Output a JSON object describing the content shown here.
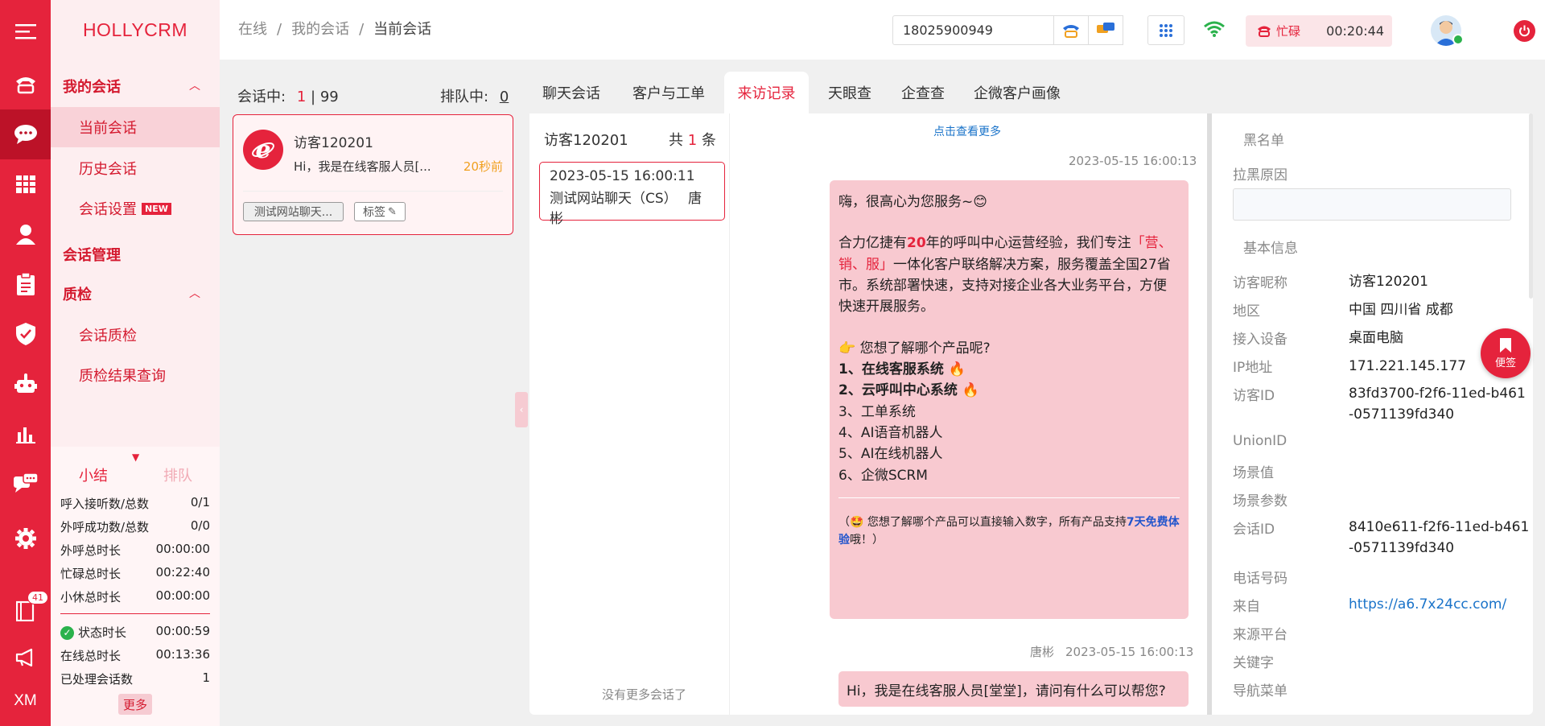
{
  "rail": {
    "badge": "41",
    "footer": "XM"
  },
  "logo": "HOLLYCRM",
  "menu": {
    "group1": "我的会话",
    "current": "当前会话",
    "history": "历史会话",
    "settings": "会话设置",
    "new_badge": "NEW",
    "manage": "会话管理",
    "qc": "质检",
    "qc_item": "会话质检",
    "qc_result": "质检结果查询"
  },
  "stats": {
    "tab_summary": "小结",
    "tab_queue": "排队",
    "rows": [
      {
        "label": "呼入接听数/总数",
        "value": "0/1"
      },
      {
        "label": "外呼成功数/总数",
        "value": "0/0"
      },
      {
        "label": "外呼总时长",
        "value": "00:00:00"
      },
      {
        "label": "忙碌总时长",
        "value": "00:22:40"
      },
      {
        "label": "小休总时长",
        "value": "00:00:00"
      }
    ],
    "rows2": [
      {
        "label": "状态时长",
        "value": "00:00:59"
      },
      {
        "label": "在线总时长",
        "value": "00:13:36"
      },
      {
        "label": "已处理会话数",
        "value": "1"
      }
    ],
    "more": "更多"
  },
  "breadcrumb": {
    "a": "在线",
    "b": "我的会话",
    "c": "当前会话",
    "sep": "/"
  },
  "topbar": {
    "phone": "18025900949",
    "status": "忙碌",
    "timer": "00:20:44"
  },
  "sessions": {
    "active_label": "会话中:",
    "active_count": "1",
    "active_sep": "|",
    "active_total": "99",
    "queue_label": "排队中:",
    "queue_count": "0",
    "card": {
      "name": "访客120201",
      "preview": "Hi，我是在线客服人员[...",
      "time": "20秒前",
      "tag1": "测试网站聊天...",
      "tag2": "标签"
    }
  },
  "tabs": [
    "聊天会话",
    "客户与工单",
    "来访记录",
    "天眼查",
    "企查查",
    "企微客户画像"
  ],
  "records": {
    "visitor": "访客120201",
    "total_prefix": "共",
    "total_count": "1",
    "total_suffix": "条",
    "item_time": "2023-05-15 16:00:11",
    "item_title": "测试网站聊天（CS）",
    "item_agent": "唐彬",
    "no_more": "没有更多会话了"
  },
  "chat": {
    "view_more": "点击查看更多",
    "msg1_time": "2023-05-15 16:00:13",
    "greet": "嗨，很高心为您服务~😊",
    "p1_a": "合力亿捷有",
    "p1_b": "20",
    "p1_c": "年的呼叫中心运营经验，我们专注",
    "p1_d": "「营、销、服」",
    "p1_e": "一体化客户联络解决方案，服务覆盖全国27省市。系统部署快速，支持对接企业各大业务平台，方便快速开展服务。",
    "q": "👉 您想了解哪个产品呢?",
    "l1": "1、在线客服系统 🔥",
    "l2": "2、云呼叫中心系统 🔥",
    "l3": "3、工单系统",
    "l4": "4、AI语音机器人",
    "l5": "5、AI在线机器人",
    "l6": "6、企微SCRM",
    "note_a": "（🤩 您想了解哪个产品可以直接输入数字，所有产品支持",
    "note_b": "7天免费体验",
    "note_c": "哦！）",
    "msg2_agent": "唐彬",
    "msg2_time": "2023-05-15 16:00:13",
    "msg2": "Hi，我是在线客服人员[堂堂]，请问有什么可以帮您?"
  },
  "info": {
    "blacklist": "黑名单",
    "reason_label": "拉黑原因",
    "basic": "基本信息",
    "fields": [
      {
        "label": "访客昵称",
        "value": "访客120201"
      },
      {
        "label": "地区",
        "value": "中国 四川省 成都"
      },
      {
        "label": "接入设备",
        "value": "桌面电脑"
      },
      {
        "label": "IP地址",
        "value": "171.221.145.177"
      },
      {
        "label": "访客ID",
        "value": "83fd3700-f2f6-11ed-b461-0571139fd340"
      },
      {
        "label": "UnionID",
        "value": ""
      },
      {
        "label": "场景值",
        "value": ""
      },
      {
        "label": "场景参数",
        "value": ""
      },
      {
        "label": "会话ID",
        "value": "8410e611-f2f6-11ed-b461-0571139fd340"
      },
      {
        "label": "电话号码",
        "value": ""
      },
      {
        "label": "来自",
        "value": "https://a6.7x24cc.com/"
      },
      {
        "label": "来源平台",
        "value": ""
      },
      {
        "label": "关键字",
        "value": ""
      },
      {
        "label": "导航菜单",
        "value": ""
      }
    ],
    "fav": "便签"
  },
  "colors": {
    "brand": "#e5233c",
    "bubble": "#f8c9d0"
  }
}
